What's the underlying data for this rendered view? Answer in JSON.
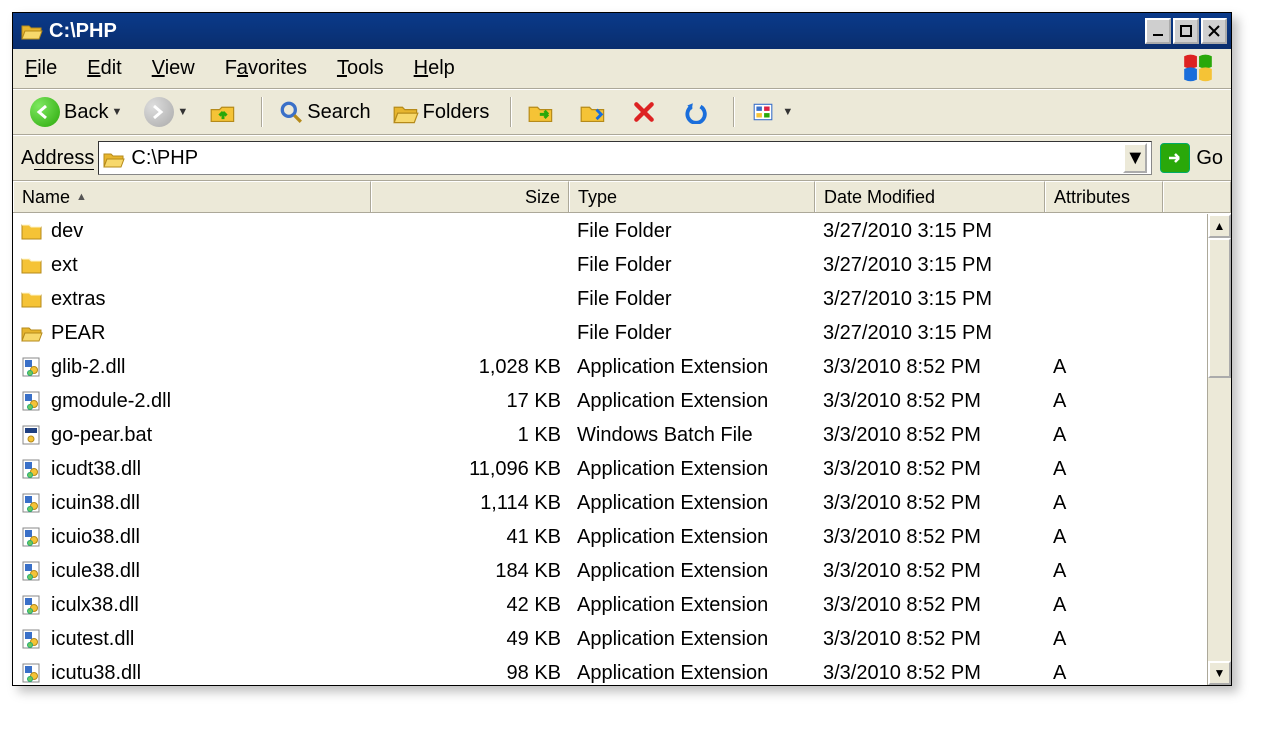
{
  "title": "C:\\PHP",
  "menu": {
    "file": "File",
    "edit": "Edit",
    "view": "View",
    "favorites": "Favorites",
    "tools": "Tools",
    "help": "Help"
  },
  "toolbar": {
    "back": "Back",
    "search": "Search",
    "folders": "Folders"
  },
  "address": {
    "label": "Address",
    "path": "C:\\PHP",
    "go": "Go"
  },
  "columns": {
    "name": "Name",
    "size": "Size",
    "type": "Type",
    "date": "Date Modified",
    "attr": "Attributes"
  },
  "rows": [
    {
      "icon": "folder",
      "name": "dev",
      "size": "",
      "type": "File Folder",
      "date": "3/27/2010 3:15 PM",
      "attr": ""
    },
    {
      "icon": "folder",
      "name": "ext",
      "size": "",
      "type": "File Folder",
      "date": "3/27/2010 3:15 PM",
      "attr": ""
    },
    {
      "icon": "folder",
      "name": "extras",
      "size": "",
      "type": "File Folder",
      "date": "3/27/2010 3:15 PM",
      "attr": ""
    },
    {
      "icon": "folder-open",
      "name": "PEAR",
      "size": "",
      "type": "File Folder",
      "date": "3/27/2010 3:15 PM",
      "attr": ""
    },
    {
      "icon": "dll",
      "name": "glib-2.dll",
      "size": "1,028 KB",
      "type": "Application Extension",
      "date": "3/3/2010 8:52 PM",
      "attr": "A"
    },
    {
      "icon": "dll",
      "name": "gmodule-2.dll",
      "size": "17 KB",
      "type": "Application Extension",
      "date": "3/3/2010 8:52 PM",
      "attr": "A"
    },
    {
      "icon": "bat",
      "name": "go-pear.bat",
      "size": "1 KB",
      "type": "Windows Batch File",
      "date": "3/3/2010 8:52 PM",
      "attr": "A"
    },
    {
      "icon": "dll",
      "name": "icudt38.dll",
      "size": "11,096 KB",
      "type": "Application Extension",
      "date": "3/3/2010 8:52 PM",
      "attr": "A"
    },
    {
      "icon": "dll",
      "name": "icuin38.dll",
      "size": "1,114 KB",
      "type": "Application Extension",
      "date": "3/3/2010 8:52 PM",
      "attr": "A"
    },
    {
      "icon": "dll",
      "name": "icuio38.dll",
      "size": "41 KB",
      "type": "Application Extension",
      "date": "3/3/2010 8:52 PM",
      "attr": "A"
    },
    {
      "icon": "dll",
      "name": "icule38.dll",
      "size": "184 KB",
      "type": "Application Extension",
      "date": "3/3/2010 8:52 PM",
      "attr": "A"
    },
    {
      "icon": "dll",
      "name": "iculx38.dll",
      "size": "42 KB",
      "type": "Application Extension",
      "date": "3/3/2010 8:52 PM",
      "attr": "A"
    },
    {
      "icon": "dll",
      "name": "icutest.dll",
      "size": "49 KB",
      "type": "Application Extension",
      "date": "3/3/2010 8:52 PM",
      "attr": "A"
    },
    {
      "icon": "dll",
      "name": "icutu38.dll",
      "size": "98 KB",
      "type": "Application Extension",
      "date": "3/3/2010 8:52 PM",
      "attr": "A"
    }
  ]
}
